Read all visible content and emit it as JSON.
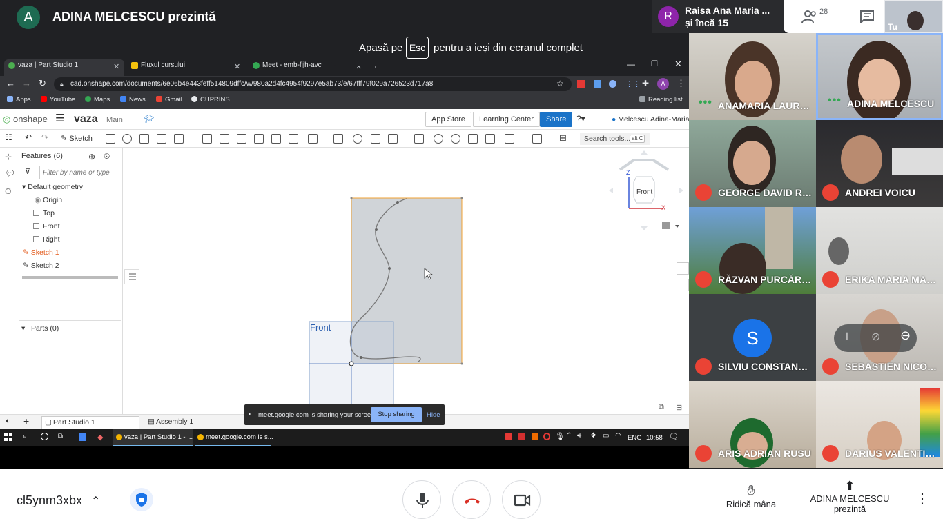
{
  "meet": {
    "presenter_initial": "A",
    "presenter_title": "ADINA MELCESCU prezintă",
    "top_participant_initial": "R",
    "top_participant_name": "Raisa Ana Maria ...",
    "top_participant_more": "și încă 15",
    "people_count": "28",
    "self_label": "Tu",
    "esc_pre": "Apasă pe",
    "esc_key": "Esc",
    "esc_post": "pentru a ieși din ecranul complet",
    "meeting_code": "cl5ynm3xbx",
    "raise_hand_label": "Ridică mâna",
    "present_label_1": "ADINA MELCESCU",
    "present_label_2": "prezintă",
    "accent_red": "#ea4335"
  },
  "participants": [
    {
      "name": "ANAMARIA LAURA ...",
      "state": "speaking"
    },
    {
      "name": "ADINA MELCESCU",
      "state": "speaking"
    },
    {
      "name": "GEORGE DAVID RUS",
      "state": "muted"
    },
    {
      "name": "ANDREI VOICU",
      "state": "muted"
    },
    {
      "name": "RĂZVAN PURCĂREA",
      "state": "muted"
    },
    {
      "name": "ERIKA MARIA MARI...",
      "state": "muted"
    },
    {
      "name": "SILVIU CONSTANTI...",
      "state": "muted",
      "initial": "S"
    },
    {
      "name": "SEBASTIEN NICOL...",
      "state": "muted"
    },
    {
      "name": "ARIS ADRIAN RUSU",
      "state": "muted"
    },
    {
      "name": "DARIUS VALENTIN ...",
      "state": "muted"
    }
  ],
  "browser": {
    "tabs": [
      {
        "label": "vaza | Part Studio 1"
      },
      {
        "label": "Fluxul cursului"
      },
      {
        "label": "Meet - emb-fjjh-avc"
      }
    ],
    "url": "cad.onshape.com/documents/6e06b4e443feff514809dffc/w/980a2d4fc4954f9297e5ab73/e/67fff79f029a726523d717a8",
    "bookmarks": [
      "Apps",
      "YouTube",
      "Maps",
      "News",
      "Gmail",
      "CUPRINS"
    ],
    "reading_list": "Reading list"
  },
  "onshape": {
    "logo": "onshape",
    "doc_name": "vaza",
    "workspace": "Main",
    "app_store": "App Store",
    "learning_center": "Learning Center",
    "share": "Share",
    "user": "Melcescu Adina-Maria",
    "sketch_tool": "Sketch",
    "search_tools": "Search tools...",
    "search_shortcut": "alt C",
    "features_title": "Features (6)",
    "filter_placeholder": "Filter by name or type",
    "tree": {
      "default_geometry": "Default geometry",
      "origin": "Origin",
      "top": "Top",
      "front": "Front",
      "right": "Right",
      "sketch1": "Sketch 1",
      "sketch2": "Sketch 2"
    },
    "parts": "Parts (0)",
    "plane_label": "Front",
    "viewcube_label": "Front",
    "axis_z": "Z",
    "axis_x": "X",
    "bottom_tabs": [
      "Part Studio 1",
      "Assembly 1"
    ]
  },
  "sharing_bar": {
    "text": "meet.google.com is sharing your screen.",
    "stop": "Stop sharing",
    "hide": "Hide"
  },
  "taskbar": {
    "apps": [
      "vaza | Part Studio 1 - ...",
      "meet.google.com is s..."
    ],
    "lang": "ENG",
    "time": "10:58"
  }
}
